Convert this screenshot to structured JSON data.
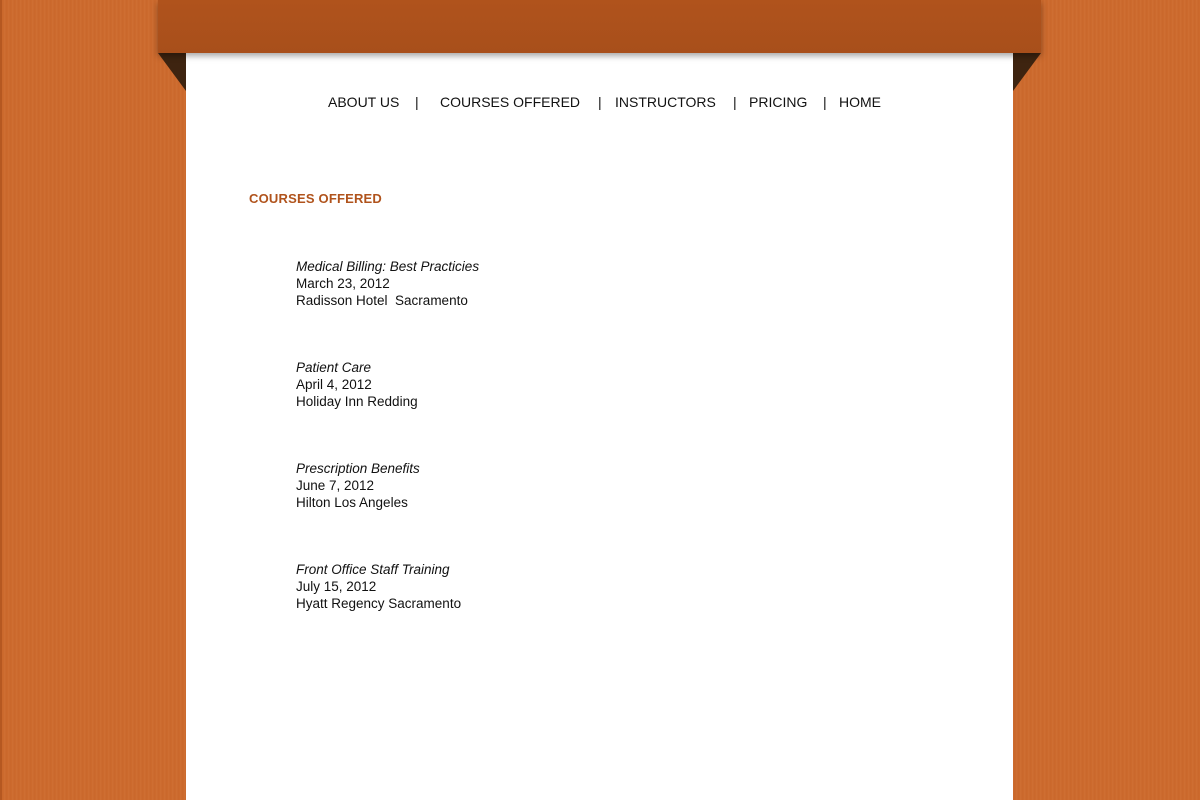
{
  "nav": {
    "items": [
      "ABOUT US",
      "COURSES OFFERED",
      "INSTRUCTORS",
      "PRICING",
      "HOME"
    ],
    "separator": "|"
  },
  "page": {
    "heading": "COURSES OFFERED"
  },
  "courses": [
    {
      "title": "Medical Billing: Best Practicies",
      "date": "March 23, 2012",
      "venue": "Radisson Hotel  Sacramento"
    },
    {
      "title": "Patient Care",
      "date": "April 4, 2012",
      "venue": "Holiday Inn Redding"
    },
    {
      "title": "Prescription Benefits",
      "date": "June 7, 2012",
      "venue": "Hilton Los Angeles"
    },
    {
      "title": "Front Office Staff Training",
      "date": "July 15, 2012",
      "venue": "Hyatt Regency Sacramento"
    }
  ],
  "colors": {
    "background": "#cd6a2d",
    "header": "#ab501b",
    "heading": "#b0531c",
    "paper": "#ffffff"
  }
}
